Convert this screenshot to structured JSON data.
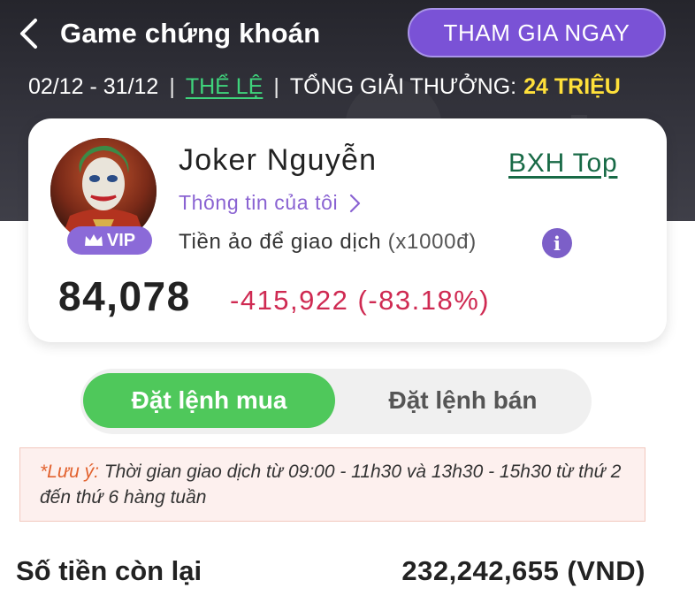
{
  "header": {
    "title": "Game chứng khoán",
    "join_button": "THAM GIA NGAY",
    "date_range": "02/12 - 31/12",
    "rules_link": "THỂ LỆ",
    "prize_label": "TỔNG GIẢI THƯỞNG:",
    "prize_value": "24 TRIỆU",
    "back_icon": "chevron-left-icon"
  },
  "profile": {
    "name": "Joker Nguyễn",
    "vip_label": "VIP",
    "my_info_link": "Thông tin của tôi",
    "leaderboard_link": "BXH Top",
    "virtual_money_label": "Tiền ảo để giao dịch",
    "virtual_money_unit": "(x1000đ)",
    "info_icon_glyph": "i",
    "balance": "84,078",
    "change": "-415,922 (-83.18%)"
  },
  "order_tabs": {
    "buy": "Đặt lệnh mua",
    "sell": "Đặt lệnh bán",
    "active": "buy"
  },
  "notice": {
    "label": "*Lưu ý:",
    "text": " Thời gian giao dịch từ 09:00 - 11h30 và 13h30 - 15h30 từ thứ 2 đến thứ 6 hàng tuần"
  },
  "remaining": {
    "label": "Số tiền còn lại",
    "value": "232,242,655 (VND)"
  },
  "colors": {
    "accent_purple": "#7a52d6",
    "buy_green": "#4fc85b",
    "negative_red": "#cf2a52",
    "prize_yellow": "#ffe03a"
  }
}
